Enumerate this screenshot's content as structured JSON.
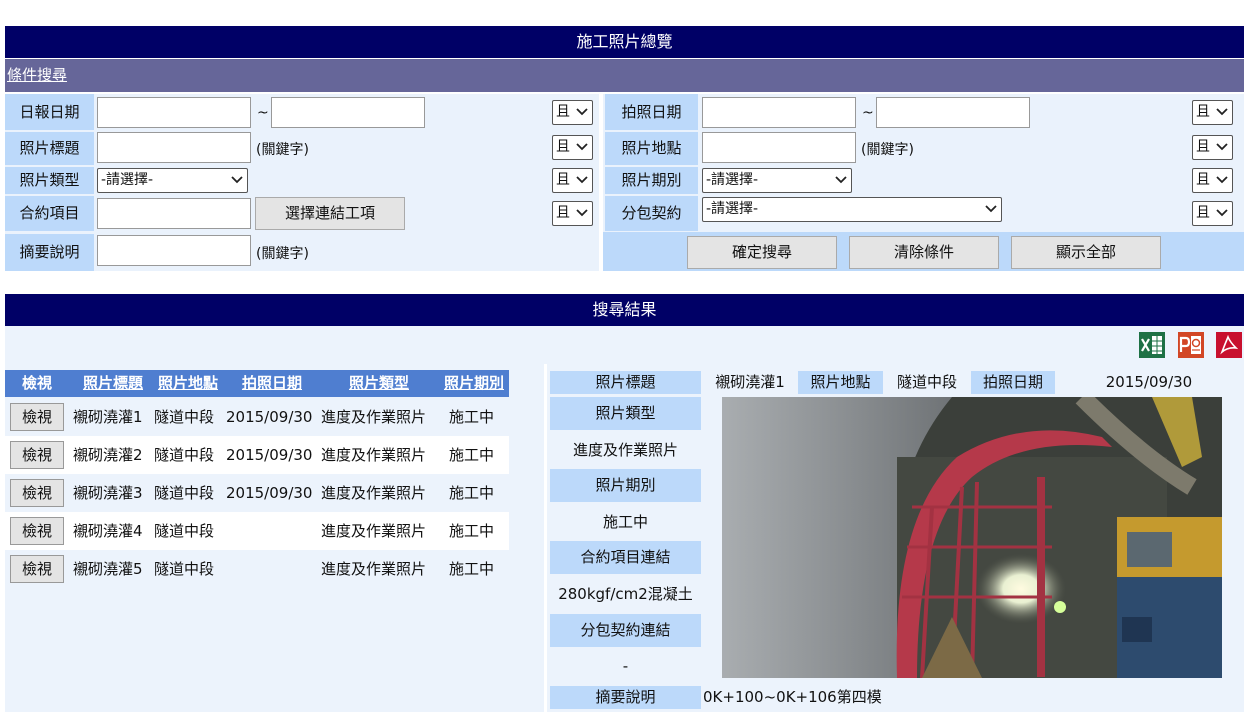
{
  "page_title": "施工照片總覽",
  "search": {
    "section_label": "條件搜尋",
    "rows": {
      "report_date_label": "日報日期",
      "range_sep": "~",
      "photo_date_label": "拍照日期",
      "photo_title_label": "照片標題",
      "keyword_hint": "(關鍵字)",
      "photo_location_label": "照片地點",
      "photo_type_label": "照片類型",
      "please_select": "-請選擇-",
      "photo_period_label": "照片期別",
      "contract_item_label": "合約項目",
      "select_link_button": "選擇連結工項",
      "subcontract_label": "分包契約",
      "summary_label": "摘要說明",
      "and_option": "且"
    },
    "buttons": {
      "search": "確定搜尋",
      "clear": "清除條件",
      "show_all": "顯示全部"
    }
  },
  "results": {
    "section_label": "搜尋結果",
    "export_icons": [
      "excel-icon",
      "powerpoint-icon",
      "pdf-icon"
    ],
    "columns": [
      "檢視",
      "照片標題",
      "照片地點",
      "拍照日期",
      "照片類型",
      "照片期別"
    ],
    "view_label": "檢視",
    "rows": [
      {
        "title": "襯砌澆灌1",
        "location": "隧道中段",
        "date": "2015/09/30",
        "type": "進度及作業照片",
        "period": "施工中"
      },
      {
        "title": "襯砌澆灌2",
        "location": "隧道中段",
        "date": "2015/09/30",
        "type": "進度及作業照片",
        "period": "施工中"
      },
      {
        "title": "襯砌澆灌3",
        "location": "隧道中段",
        "date": "2015/09/30",
        "type": "進度及作業照片",
        "period": "施工中"
      },
      {
        "title": "襯砌澆灌4",
        "location": "隧道中段",
        "date": "",
        "type": "進度及作業照片",
        "period": "施工中"
      },
      {
        "title": "襯砌澆灌5",
        "location": "隧道中段",
        "date": "",
        "type": "進度及作業照片",
        "period": "施工中"
      }
    ]
  },
  "detail": {
    "title_label": "照片標題",
    "title_value": "襯砌澆灌1",
    "location_label": "照片地點",
    "location_value": "隧道中段",
    "date_label": "拍照日期",
    "date_value": "2015/09/30",
    "type_label": "照片類型",
    "type_value": "進度及作業照片",
    "period_label": "照片期別",
    "period_value": "施工中",
    "contract_link_label": "合約項目連結",
    "contract_link_value": "280kgf/cm2混凝土",
    "subcontract_link_label": "分包契約連結",
    "subcontract_link_value": "-",
    "summary_label": "摘要說明",
    "summary_value": "0K+100~0K+106第四模"
  },
  "colors": {
    "navy": "#000066",
    "section": "#666699",
    "label_bg": "#bcd9fa",
    "header_blue": "#4f7ed0"
  }
}
